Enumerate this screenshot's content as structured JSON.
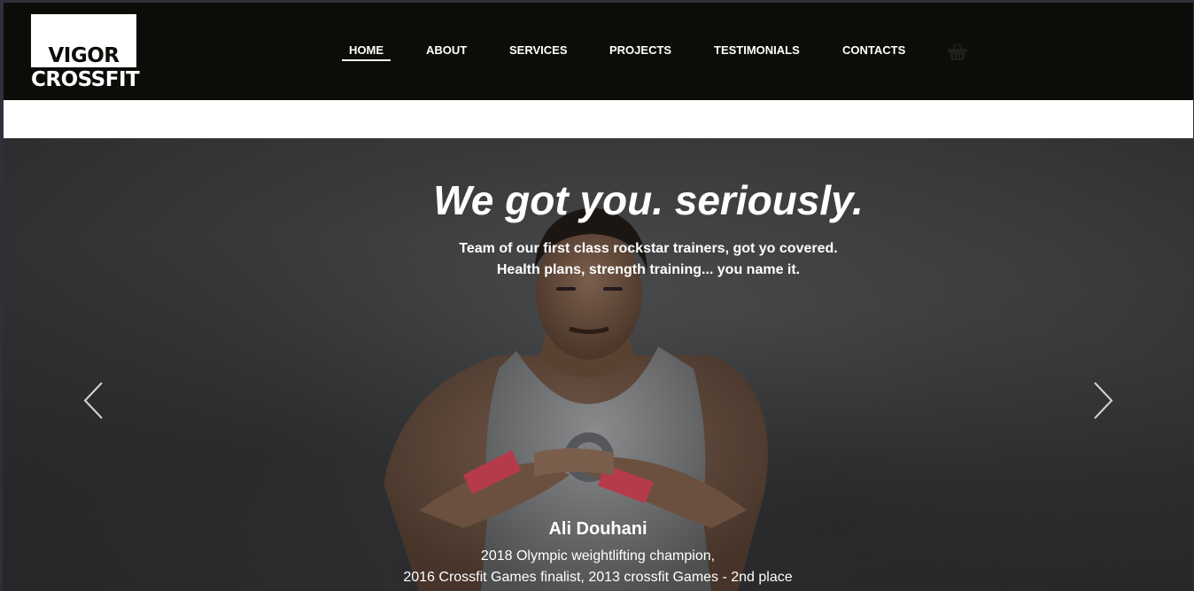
{
  "brand": {
    "line1": "VIGOR",
    "line2": "CROSSFIT"
  },
  "nav": {
    "home": "HOME",
    "about": "ABOUT",
    "services": "SERVICES",
    "projects": "PROJECTS",
    "testimonials": "TESTIMONIALS",
    "contacts": "CONTACTS",
    "cart_icon": "shopping-basket-icon"
  },
  "hero": {
    "title": "We got you. seriously.",
    "subtitle_line1": "Team of our first class rockstar trainers, got yo covered.",
    "subtitle_line2": "Health plans, strength training... you name it.",
    "prev_icon": "chevron-left-icon",
    "next_icon": "chevron-right-icon",
    "caption": {
      "name": "Ali Douhani",
      "line1": "2018 Olympic weightlifting champion,",
      "line2": "2016 Crossfit Games finalist, 2013 crossfit Games - 2nd place"
    }
  },
  "colors": {
    "navbar_bg": "#0c0c09",
    "text": "#ffffff",
    "page_frame": "#30303a"
  }
}
